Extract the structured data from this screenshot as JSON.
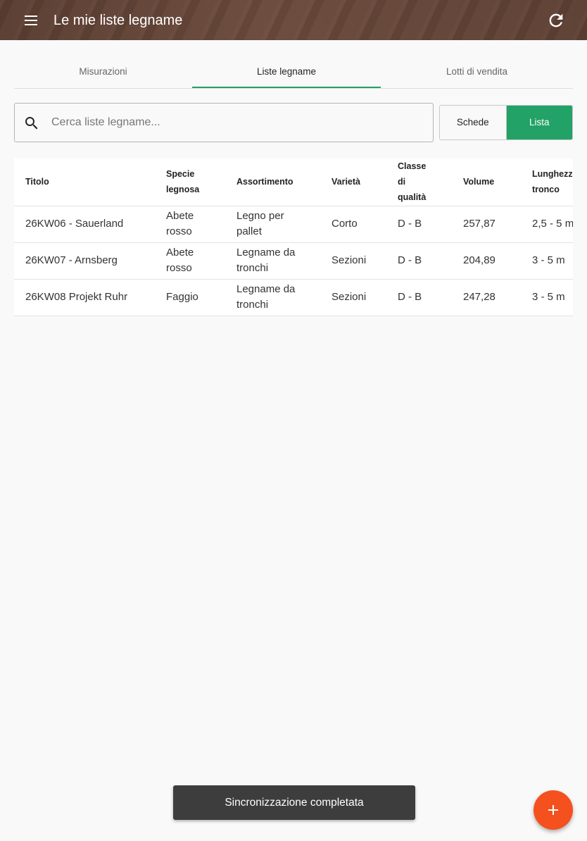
{
  "app": {
    "title": "Le mie liste legname",
    "menu_icon": "menu-icon",
    "refresh_icon": "refresh-icon"
  },
  "tabs": [
    {
      "label": "Misurazioni",
      "active": false
    },
    {
      "label": "Liste legname",
      "active": true
    },
    {
      "label": "Lotti di vendita",
      "active": false
    }
  ],
  "search": {
    "placeholder": "Cerca liste legname...",
    "value": "",
    "icon": "search-icon"
  },
  "view_toggle": {
    "options": [
      "Schede",
      "Lista"
    ],
    "selected": "Lista"
  },
  "table": {
    "headers": [
      "Titolo",
      "Specie legnosa",
      "Assortimento",
      "Varietà",
      "Classe di qualità",
      "Volume",
      "Lunghezza tronco"
    ],
    "rows": [
      [
        "26KW06 - Sauerland",
        "Abete rosso",
        "Legno per pallet",
        "Corto",
        "D - B",
        "257,87",
        "2,5 - 5 m"
      ],
      [
        "26KW07 - Arnsberg",
        "Abete rosso",
        "Legname da tronchi",
        "Sezioni",
        "D - B",
        "204,89",
        "3 - 5 m"
      ],
      [
        "26KW08 Projekt Ruhr",
        "Faggio",
        "Legname da tronchi",
        "Sezioni",
        "D - B",
        "247,28",
        "3 - 5 m"
      ]
    ]
  },
  "snackbar": {
    "text": "Sincronizzazione completata"
  },
  "fab": {
    "icon": "add-icon"
  },
  "colors": {
    "appbar": "#5c3f33",
    "accent": "#22a266",
    "fab": "#f4511e",
    "snackbar": "#3d3d3d"
  }
}
